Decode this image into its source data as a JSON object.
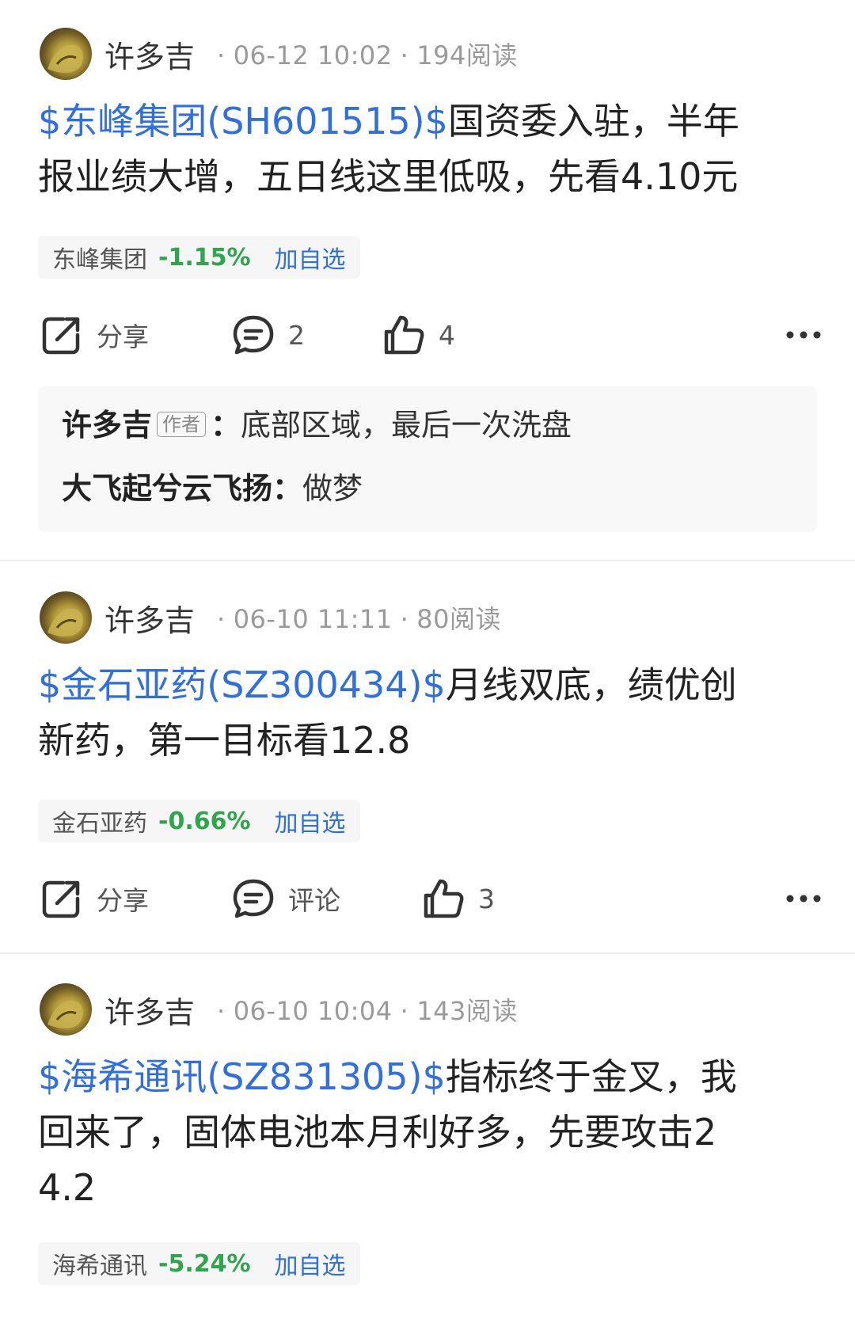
{
  "posts": [
    {
      "author": "许多吉",
      "date": "06-12 10:02",
      "reads": "194阅读",
      "stock_link": "$东峰集团(SH601515)$",
      "body_line1": "国资委入驻，半年",
      "body_line2": "报业绩大增，五日线这里低吸，先看4.10元",
      "stock_name": "东峰集团",
      "stock_change": "-1.15%",
      "add_label": "加自选",
      "share_label": "分享",
      "comment_count": "2",
      "like_count": "4",
      "comments": [
        {
          "author": "许多吉",
          "tag": "作者",
          "sep": "：",
          "text": "底部区域，最后一次洗盘"
        },
        {
          "author": "大飞起兮云飞扬",
          "sep": "：",
          "text": "做梦"
        }
      ]
    },
    {
      "author": "许多吉",
      "date": "06-10 11:11",
      "reads": "80阅读",
      "stock_link": "$金石亚药(SZ300434)$",
      "body_line1": "月线双底，绩优创",
      "body_line2": "新药，第一目标看12.8",
      "stock_name": "金石亚药",
      "stock_change": "-0.66%",
      "add_label": "加自选",
      "share_label": "分享",
      "comment_label": "评论",
      "like_count": "3"
    },
    {
      "author": "许多吉",
      "date": "06-10 10:04",
      "reads": "143阅读",
      "stock_link": "$海希通讯(SZ831305)$",
      "body_line1": "指标终于金叉，我",
      "body_line2": "回来了，固体电池本月利好多，先要攻击2",
      "body_line3": "4.2",
      "stock_name": "海希通讯",
      "stock_change": "-5.24%",
      "add_label": "加自选"
    }
  ],
  "colors": {
    "link": "#2f6fe0",
    "down": "#2fa54d",
    "meta": "#9a9a9a"
  },
  "icons": {
    "share": "share-icon",
    "comment": "comment-icon",
    "like": "thumbs-up-icon",
    "more": "more-icon"
  }
}
